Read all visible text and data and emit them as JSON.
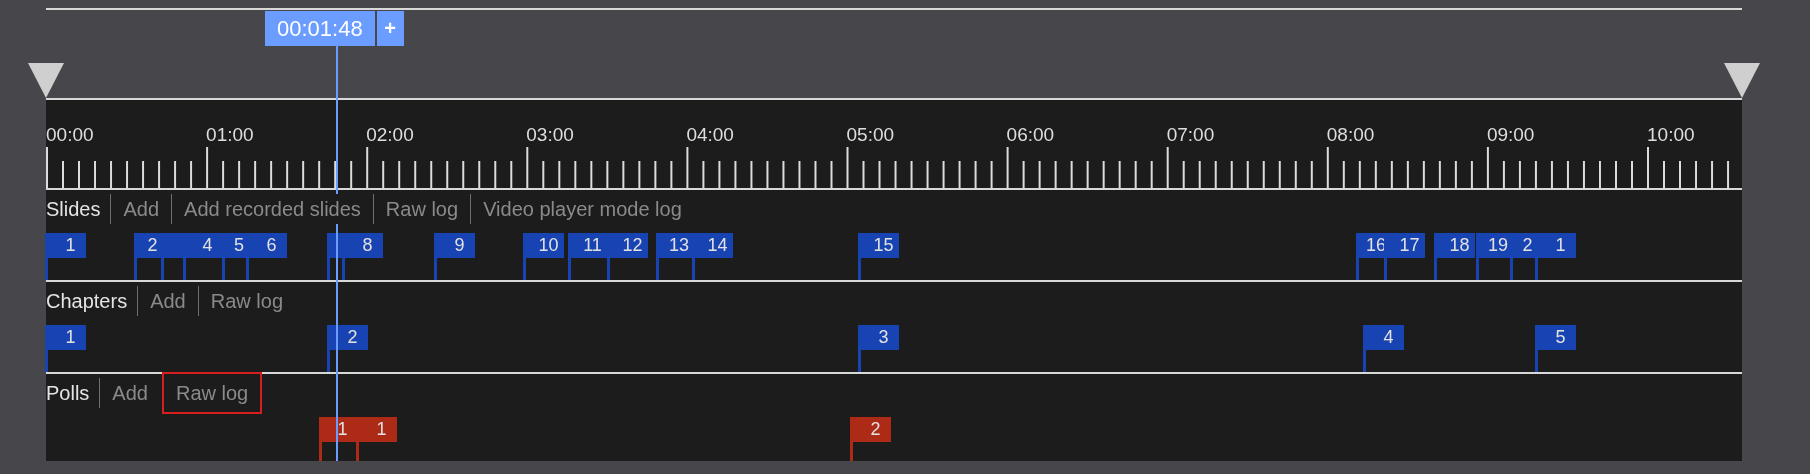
{
  "playhead": {
    "time": "00:01:48",
    "add_label": "+"
  },
  "ruler_labels": [
    "00:00",
    "01:00",
    "02:00",
    "03:00",
    "04:00",
    "05:00",
    "06:00",
    "07:00",
    "08:00",
    "09:00",
    "10:00"
  ],
  "tracks": [
    {
      "kind": "slides",
      "title": "Slides",
      "links": [
        {
          "label": "Add",
          "selected": false
        },
        {
          "label": "Add recorded slides",
          "selected": false
        },
        {
          "label": "Raw log",
          "selected": false
        },
        {
          "label": "Video player mode log",
          "selected": false
        }
      ],
      "flags": [
        {
          "label": "1"
        },
        {
          "label": "2"
        },
        {
          "kind": "covered"
        },
        {
          "label": "4"
        },
        {
          "label": "5"
        },
        {
          "label": "6"
        },
        {
          "kind": "covered"
        },
        {
          "label": "8"
        },
        {
          "label": "9"
        },
        {
          "label": "10"
        },
        {
          "label": "11"
        },
        {
          "label": "12"
        },
        {
          "label": "13"
        },
        {
          "label": "14"
        },
        {
          "label": "15"
        },
        {
          "label": "16"
        },
        {
          "label": "17"
        },
        {
          "label": "18"
        },
        {
          "label": "19"
        },
        {
          "label": "2"
        },
        {
          "label": "1"
        }
      ]
    },
    {
      "kind": "chapters",
      "title": "Chapters",
      "links": [
        {
          "label": "Add",
          "selected": false
        },
        {
          "label": "Raw log",
          "selected": false
        }
      ],
      "flags": [
        {
          "label": "1"
        },
        {
          "label": "2"
        },
        {
          "label": "3"
        },
        {
          "label": "4"
        },
        {
          "label": "5"
        }
      ]
    },
    {
      "kind": "polls",
      "title": "Polls",
      "links": [
        {
          "label": "Add",
          "selected": false
        },
        {
          "label": "Raw log",
          "selected": true
        }
      ],
      "flags": [
        {
          "label": "1"
        },
        {
          "label": "1"
        },
        {
          "label": "2"
        }
      ]
    }
  ]
}
